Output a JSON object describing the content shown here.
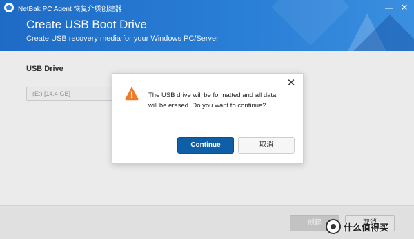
{
  "window": {
    "app_title": "NetBak PC Agent 恢复介质创建器",
    "minimize_glyph": "—",
    "close_glyph": "✕"
  },
  "header": {
    "title": "Create USB Boot Drive",
    "subtitle": "Create USB recovery media for your Windows PC/Server",
    "background_color": "#2a7fd6"
  },
  "main": {
    "usb_drive_label": "USB Drive",
    "usb_drive_value": "(E:) [14.4 GB]"
  },
  "footer": {
    "create_label": "创建",
    "cancel_label": "取消"
  },
  "dialog": {
    "icon": "warning-icon",
    "icon_color": "#f07a2a",
    "message": "The USB drive will be formatted and all data will be erased. Do you want to continue?",
    "continue_label": "Continue",
    "cancel_label": "取消",
    "close_glyph": "✕",
    "accent_color": "#0e5ea8"
  },
  "watermark": {
    "text": "什么值得买"
  }
}
